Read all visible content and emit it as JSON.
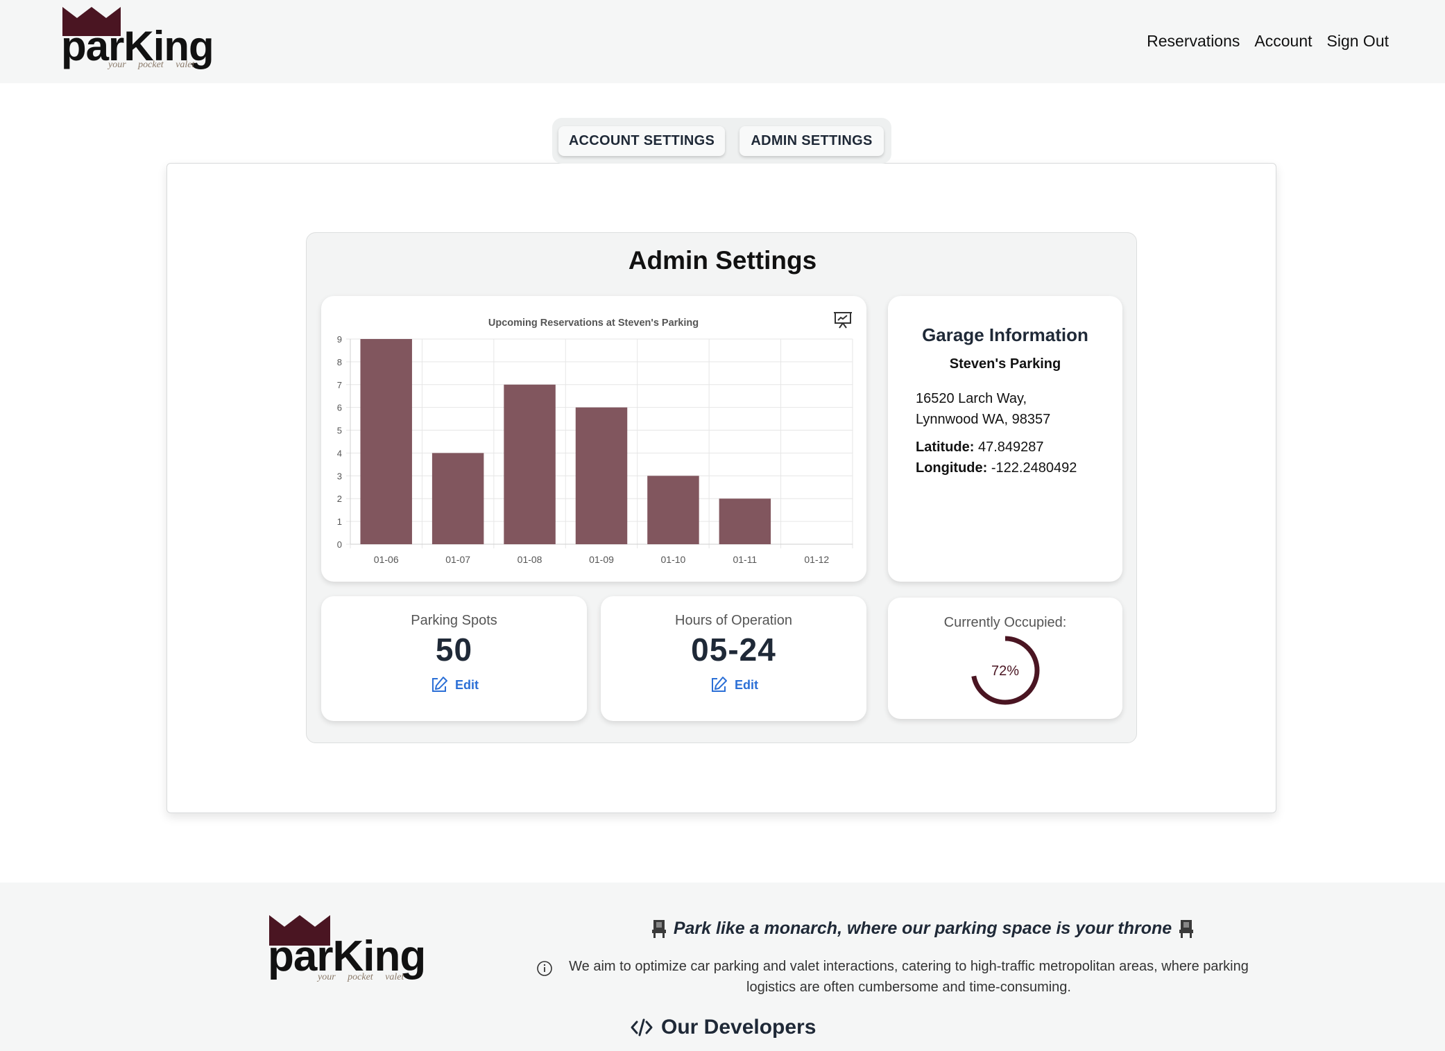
{
  "header": {
    "logo_word": "parKing",
    "logo_tagline": "your pocket valet",
    "nav": [
      "Reservations",
      "Account",
      "Sign Out"
    ]
  },
  "tabs": [
    "ACCOUNT SETTINGS",
    "ADMIN SETTINGS"
  ],
  "panel": {
    "title": "Admin Settings"
  },
  "chart_data": {
    "type": "bar",
    "title": "Upcoming Reservations at Steven's Parking",
    "categories": [
      "01-06",
      "01-07",
      "01-08",
      "01-09",
      "01-10",
      "01-11",
      "01-12"
    ],
    "values": [
      9,
      4,
      7,
      6,
      3,
      2,
      0
    ],
    "ylim": [
      0,
      9
    ],
    "yticks": [
      0,
      1,
      2,
      3,
      4,
      5,
      6,
      7,
      8,
      9
    ],
    "grid": true,
    "bar_color": "#81565e",
    "xlabel": "",
    "ylabel": ""
  },
  "chart_icon": "presentation-chart-icon",
  "garage": {
    "title": "Garage Information",
    "name": "Steven's Parking",
    "address_line1": "16520 Larch Way,",
    "address_line2": "Lynnwood WA, 98357",
    "latitude_label": "Latitude:",
    "latitude": "47.849287",
    "longitude_label": "Longitude:",
    "longitude": "-122.2480492"
  },
  "stats": {
    "spots_label": "Parking Spots",
    "spots_value": "50",
    "hours_label": "Hours of Operation",
    "hours_value": "05-24",
    "edit_label": "Edit",
    "occupied_label": "Currently Occupied:",
    "occupied_text": "72%",
    "occupied_fraction": 0.72
  },
  "footer": {
    "logo_word": "parKing",
    "logo_tagline": "your pocket valet",
    "slogan": "Park like a monarch, where our parking space is your throne",
    "mission": "We aim to optimize car parking and valet interactions, catering to high-traffic metropolitan areas, where parking logistics are often cumbersome and time-consuming.",
    "developers": "Our Developers"
  },
  "colors": {
    "brand": "#4a1522",
    "bar": "#81565e",
    "link": "#2b6fd6",
    "header_bg": "#f5f6f6"
  }
}
